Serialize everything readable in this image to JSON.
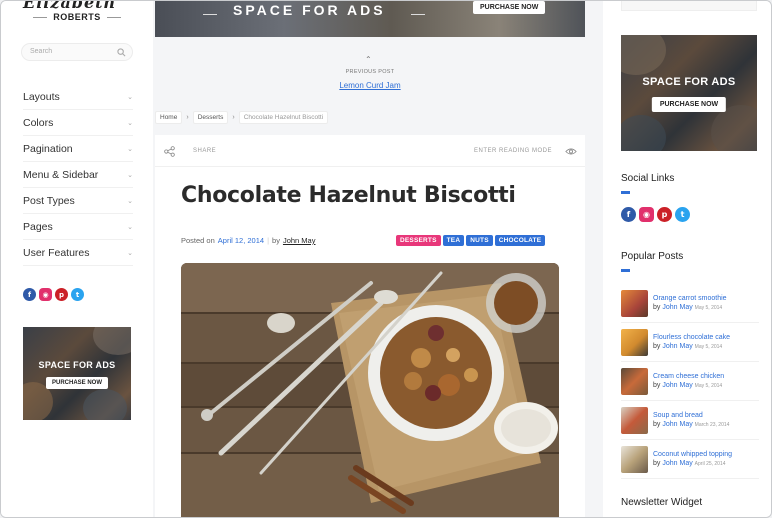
{
  "logo": {
    "script": "Elizabeth",
    "name": "ROBERTS"
  },
  "search": {
    "placeholder": "Search"
  },
  "menu": [
    {
      "label": "Layouts"
    },
    {
      "label": "Colors"
    },
    {
      "label": "Pagination"
    },
    {
      "label": "Menu & Sidebar"
    },
    {
      "label": "Post Types"
    },
    {
      "label": "Pages"
    },
    {
      "label": "User Features"
    }
  ],
  "social_icons": [
    "facebook-icon",
    "instagram-icon",
    "pinterest-icon",
    "twitter-icon"
  ],
  "ads": {
    "title": "SPACE FOR ADS",
    "button": "PURCHASE NOW"
  },
  "previous_post": {
    "label": "PREVIOUS POST",
    "title": "Lemon Curd Jam"
  },
  "breadcrumb": [
    "Home",
    "Desserts",
    "Chocolate Hazelnut Biscotti"
  ],
  "share_bar": {
    "share": "SHARE",
    "reading_mode": "ENTER READING MODE"
  },
  "post": {
    "title": "Chocolate Hazelnut Biscotti",
    "posted_on": "Posted on",
    "date": "April 12, 2014",
    "by": "by",
    "author": "John May",
    "tags": [
      {
        "label": "DESSERTS",
        "color": "#e8377a"
      },
      {
        "label": "TEA",
        "color": "#2f6fd6"
      },
      {
        "label": "NUTS",
        "color": "#2f6fd6"
      },
      {
        "label": "CHOCOLATE",
        "color": "#2f6fd6"
      }
    ]
  },
  "right_sidebar": {
    "social_title": "Social Links",
    "popular_title": "Popular Posts",
    "newsletter_title": "Newsletter Widget",
    "accent_color": "#2f6fd6",
    "popular_posts": [
      {
        "title": "Orange carrot smoothie",
        "by": "by",
        "author": "John May",
        "date": "May 5, 2014"
      },
      {
        "title": "Flourless chocolate cake",
        "by": "by",
        "author": "John May",
        "date": "May 5, 2014"
      },
      {
        "title": "Cream cheese chicken",
        "by": "by",
        "author": "John May",
        "date": "May 5, 2014"
      },
      {
        "title": "Soup and bread",
        "by": "by",
        "author": "John May",
        "date": "March 23, 2014"
      },
      {
        "title": "Coconut whipped topping",
        "by": "by",
        "author": "John May",
        "date": "April 25, 2014"
      }
    ]
  }
}
